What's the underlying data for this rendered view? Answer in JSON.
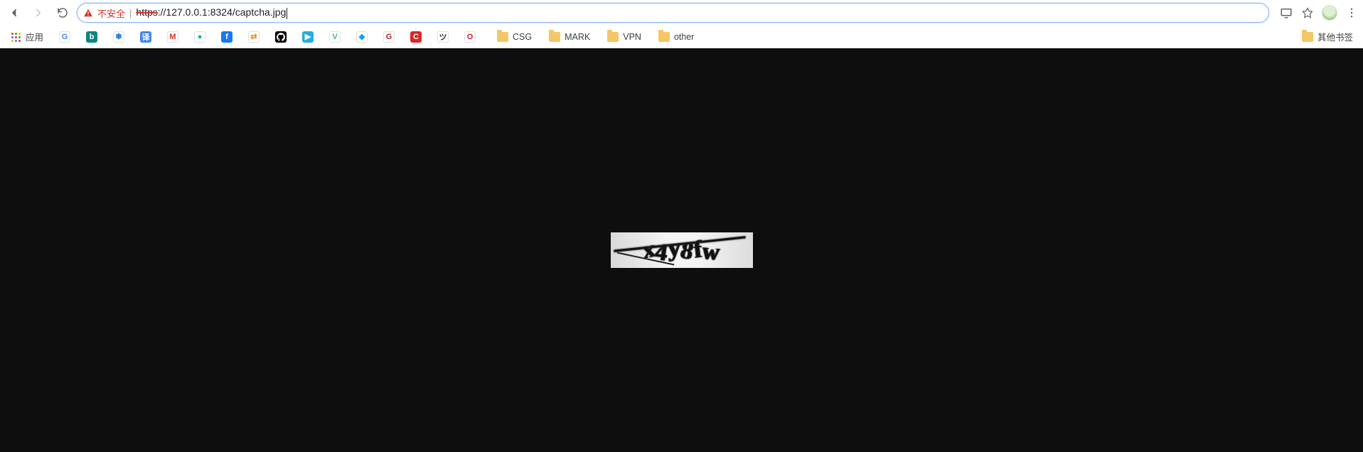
{
  "toolbar": {
    "security_text": "不安全",
    "url_scheme_struck": "https",
    "url_rest": "://127.0.0.1:8324/captcha.jpg"
  },
  "bookmarks": {
    "apps_label": "应用",
    "items": [
      {
        "label": "",
        "icon_letter": "G",
        "bg1": "#fff",
        "fg": "#4285f4",
        "name": "google"
      },
      {
        "label": "",
        "icon_letter": "b",
        "bg1": "#0c8484",
        "fg": "#fff",
        "name": "bing"
      },
      {
        "label": "",
        "icon_letter": "✽",
        "bg1": "#fff",
        "fg": "#2b7de9",
        "name": "baidu"
      },
      {
        "label": "",
        "icon_letter": "译",
        "bg1": "#4285f4",
        "fg": "#fff",
        "name": "translate"
      },
      {
        "label": "",
        "icon_letter": "M",
        "bg1": "#fff",
        "fg": "#d93025",
        "name": "gmail"
      },
      {
        "label": "",
        "icon_letter": "●",
        "bg1": "#fff",
        "fg": "#07c160",
        "name": "wechat"
      },
      {
        "label": "",
        "icon_letter": "f",
        "bg1": "#1877f2",
        "fg": "#fff",
        "name": "facebook"
      },
      {
        "label": "",
        "icon_letter": "⇄",
        "bg1": "#fff",
        "fg": "#f48c06",
        "name": "link"
      },
      {
        "label": "",
        "icon_letter": "",
        "bg1": "#000",
        "fg": "#fff",
        "name": "github",
        "svg": "github"
      },
      {
        "label": "",
        "icon_letter": "▶",
        "bg1": "#23ade5",
        "fg": "#fff",
        "name": "bilibili"
      },
      {
        "label": "",
        "icon_letter": "V",
        "bg1": "#fff",
        "fg": "#41b883",
        "name": "vue"
      },
      {
        "label": "",
        "icon_letter": "◆",
        "bg1": "#fff",
        "fg": "#0aa1ff",
        "name": "diamond"
      },
      {
        "label": "",
        "icon_letter": "G",
        "bg1": "#fff",
        "fg": "#c71d23",
        "name": "gitee"
      },
      {
        "label": "",
        "icon_letter": "C",
        "bg1": "#dc2626",
        "fg": "#fff",
        "name": "csdn"
      },
      {
        "label": "",
        "icon_letter": "ツ",
        "bg1": "#fff",
        "fg": "#333",
        "name": "jianshu"
      },
      {
        "label": "",
        "icon_letter": "O",
        "bg1": "#fff",
        "fg": "#e6162d",
        "name": "opera"
      }
    ],
    "folders": [
      {
        "label": "CSG"
      },
      {
        "label": "MARK"
      },
      {
        "label": "VPN"
      },
      {
        "label": "other"
      }
    ],
    "other_label": "其他书签"
  },
  "content": {
    "captcha_value": "x4y8fw"
  }
}
